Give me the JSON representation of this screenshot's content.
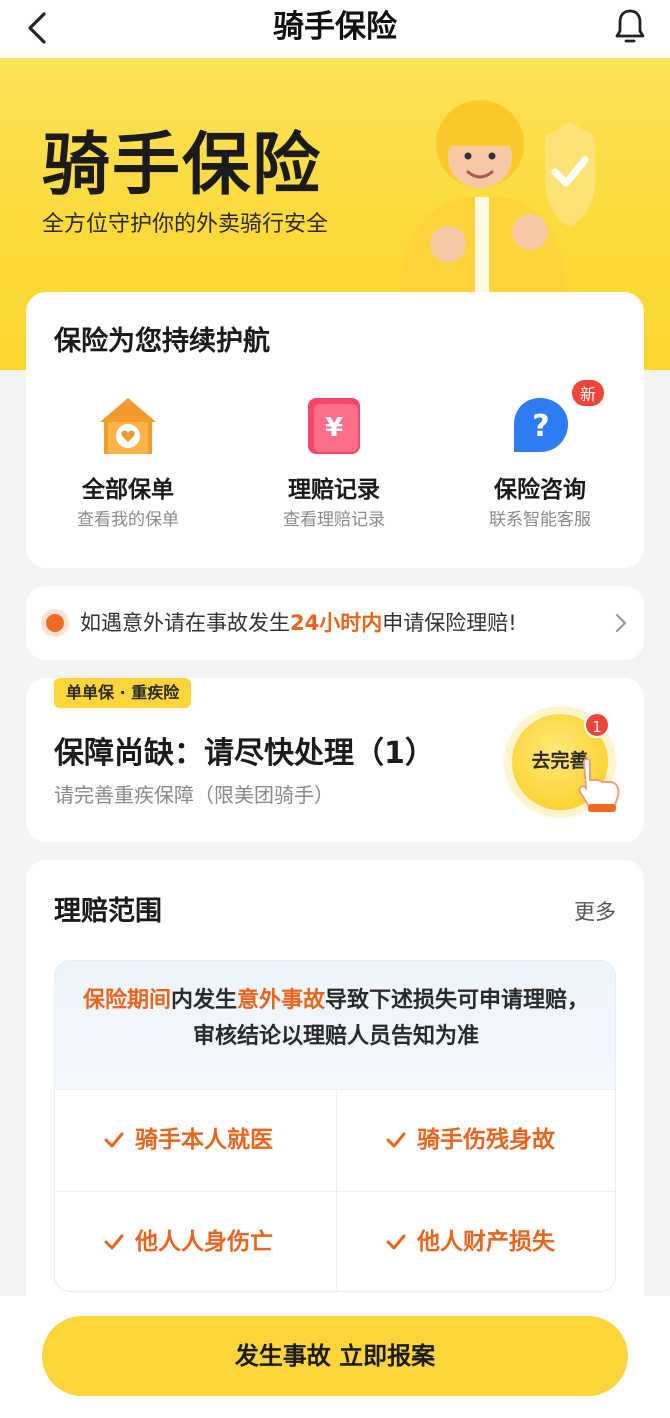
{
  "nav": {
    "title": "骑手保险",
    "back_icon": "chevron-left-icon",
    "bell_icon": "bell-icon"
  },
  "hero": {
    "title": "骑手保险",
    "subtitle": "全方位守护你的外卖骑行安全",
    "bg_color": "#fbd938"
  },
  "services": {
    "heading": "保险为您持续护航",
    "items": [
      {
        "label": "全部保单",
        "desc": "查看我的保单",
        "icon": "house-heart-icon"
      },
      {
        "label": "理赔记录",
        "desc": "查看理赔记录",
        "icon": "yuan-document-icon"
      },
      {
        "label": "保险咨询",
        "desc": "联系智能客服",
        "icon": "question-bubble-icon",
        "badge": "新"
      }
    ]
  },
  "notice": {
    "prefix": "如遇意外请在事故发生",
    "highlight": "24小时内",
    "suffix": "申请保险理赔!",
    "accent": "#e9651c"
  },
  "pending": {
    "tag": "单单保 · 重疾险",
    "title": "保障尚缺：请尽快处理（1）",
    "subtitle": "请完善重疾保障（限美团骑手）",
    "action_label": "去完善",
    "action_badge": "1"
  },
  "claims": {
    "heading": "理赔范围",
    "more_label": "更多",
    "desc": {
      "hl1": "保险期间",
      "t1": "内发生",
      "hl2": "意外事故",
      "t2": "导致下述损失可申请理赔，审核结论以理赔人员告知为准"
    },
    "items": [
      "骑手本人就医",
      "骑手伤残身故",
      "他人人身伤亡",
      "他人财产损失"
    ]
  },
  "bottom": {
    "cta_label": "发生事故 立即报案",
    "cta_color": "#fbd53a"
  }
}
